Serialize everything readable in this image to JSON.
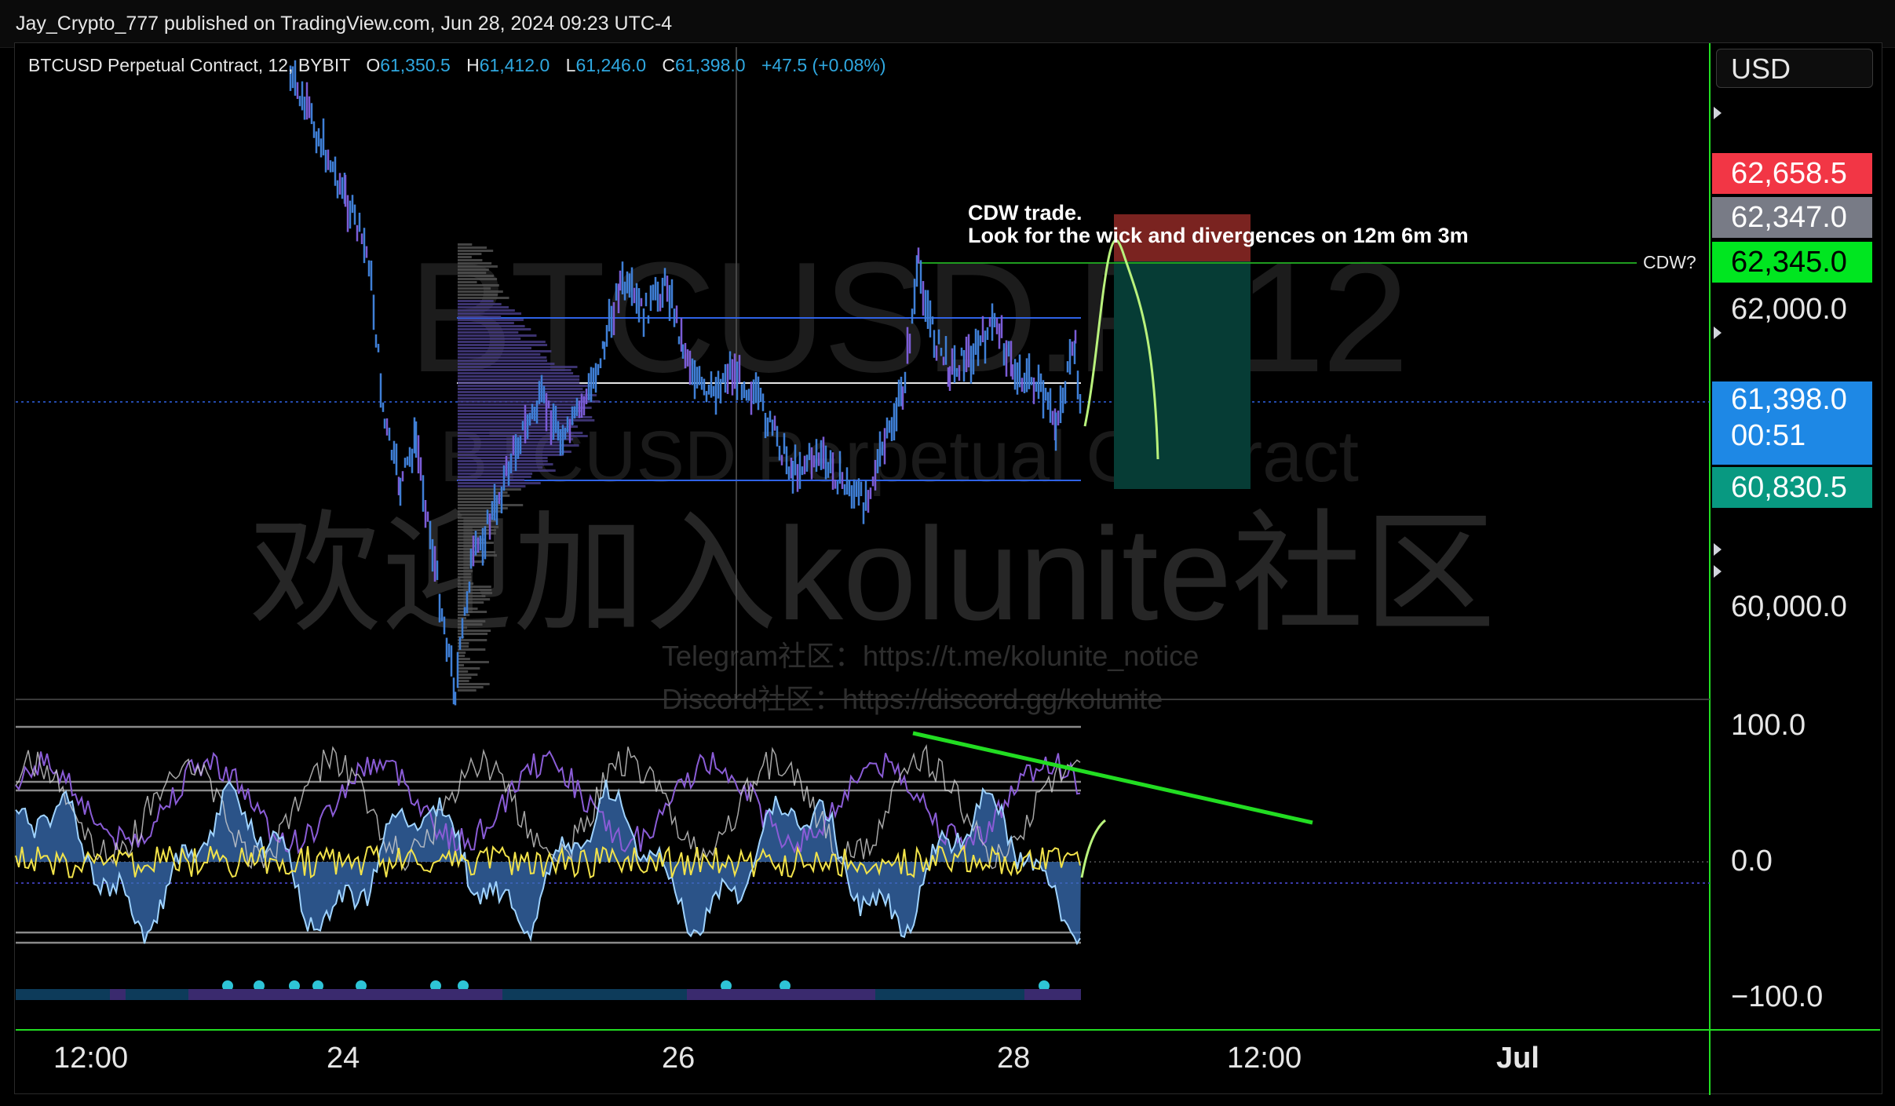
{
  "publisher_line": "Jay_Crypto_777 published on TradingView.com, Jun 28, 2024 09:23 UTC-4",
  "legend": {
    "symbol": "BTCUSD Perpetual Contract, 12, BYBIT",
    "o_label": "O",
    "o_value": "61,350.5",
    "h_label": "H",
    "h_value": "61,412.0",
    "l_label": "L",
    "l_value": "61,246.0",
    "c_label": "C",
    "c_value": "61,398.0",
    "change": "+47.5 (+0.08%)"
  },
  "currency_button": "USD",
  "price_tags": [
    {
      "name": "stop-level",
      "value": "62,658.5",
      "color": "#f23645"
    },
    {
      "name": "cursor-level",
      "value": "62,347.0",
      "color": "#787b86"
    },
    {
      "name": "cdw-level",
      "value": "62,345.0",
      "color": "#00e620"
    },
    {
      "name": "last-price",
      "value": "61,398.0",
      "countdown": "00:51",
      "color": "#1e88e5"
    },
    {
      "name": "target-level",
      "value": "60,830.5",
      "color": "#089981"
    }
  ],
  "price_axis": [
    "62,000.0",
    "60,000.0"
  ],
  "indicator_axis": [
    "100.0",
    "0.0",
    "−100.0"
  ],
  "time_axis": [
    "12:00",
    "24",
    "26",
    "28",
    "12:00",
    "Jul"
  ],
  "annotation": {
    "line1": "CDW trade.",
    "line2": "Look for the wick and divergences on 12m 6m 3m"
  },
  "cdw_label": "CDW?",
  "watermark": {
    "symbol": "BTCUSD.P, 12",
    "description": "BTCUSD Perpetual Contract",
    "promo": "欢迎加入kolunite社区",
    "telegram": "Telegram社区：https://t.me/kolunite_notice",
    "discord": "Discord社区：https://discord.gg/kolunite"
  },
  "colors": {
    "candles": "#3f7fd6",
    "horizontal_lines": "#2f62e6",
    "divergence_line": "#22dd22",
    "forecast_path": "#b9f27c",
    "stop_zone": "#7a2320",
    "target_zone": "#063c35",
    "separator": "#22dd22"
  }
}
